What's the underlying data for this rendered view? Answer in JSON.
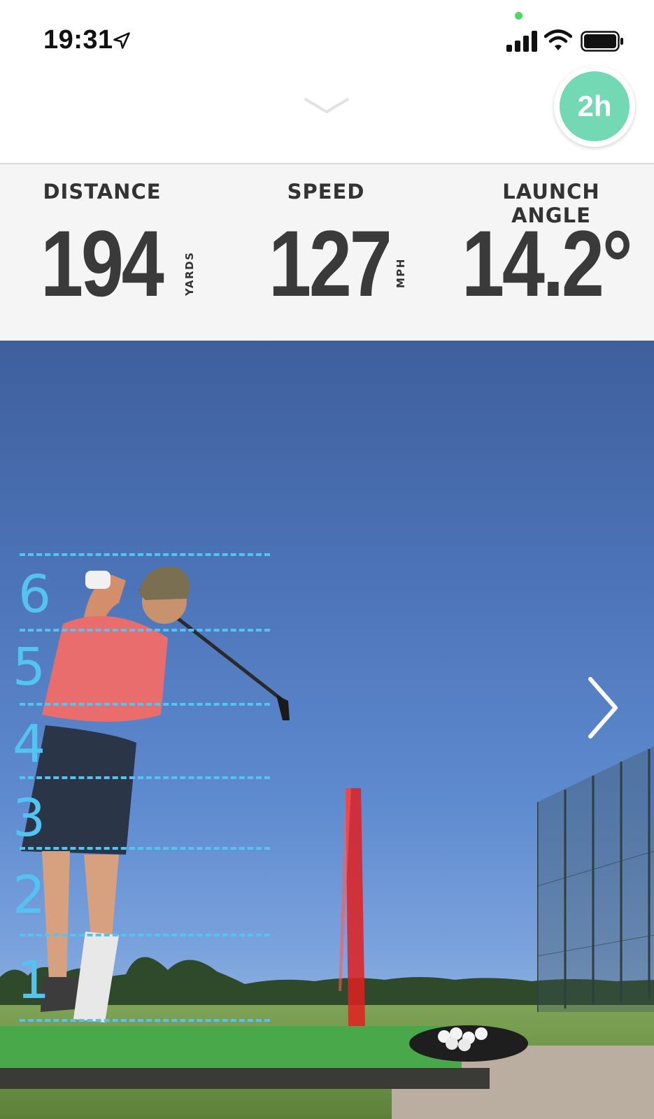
{
  "status_bar": {
    "time": "19:31",
    "icons": [
      "location-arrow-icon",
      "cellular-signal-icon",
      "wifi-icon",
      "battery-icon"
    ],
    "camera_indicator_color": "#4cd964"
  },
  "header": {
    "collapse_icon": "chevron-down-icon",
    "timer_badge": "2h",
    "timer_color": "#73d8b4"
  },
  "stats": {
    "distance": {
      "label": "DISTANCE",
      "value": "194",
      "unit": "YARDS"
    },
    "speed": {
      "label": "SPEED",
      "value": "127",
      "unit": "MPH"
    },
    "launch_angle": {
      "label": "LAUNCH ANGLE",
      "value": "14.2°"
    }
  },
  "video": {
    "zones": [
      "6",
      "5",
      "4",
      "3",
      "2",
      "1"
    ],
    "guide_color": "#55c3f2",
    "tracer_color": "#e02020",
    "next_icon": "chevron-right-icon"
  }
}
